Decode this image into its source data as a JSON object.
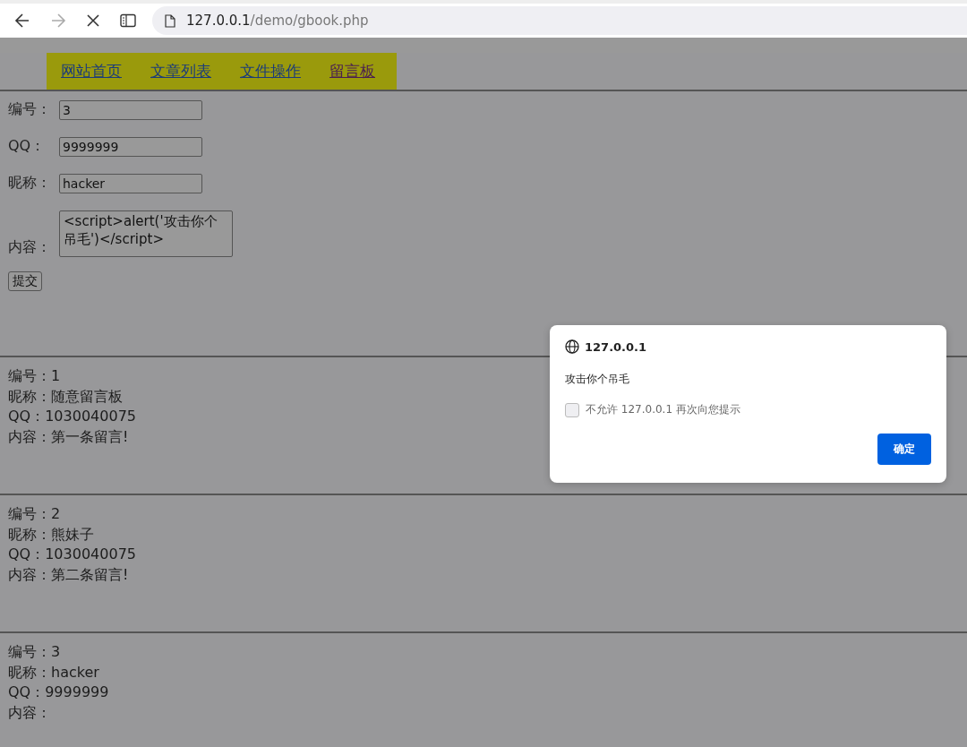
{
  "browser": {
    "url_host": "127.0.0.1",
    "url_path": "/demo/gbook.php"
  },
  "nav": [
    {
      "label": "网站首页",
      "visited": false
    },
    {
      "label": "文章列表",
      "visited": false
    },
    {
      "label": "文件操作",
      "visited": false
    },
    {
      "label": "留言板",
      "visited": true
    }
  ],
  "form": {
    "fields": [
      {
        "label": "编号：",
        "value": "3",
        "kind": "input"
      },
      {
        "label": "QQ：",
        "value": "9999999",
        "kind": "input"
      },
      {
        "label": "昵称：",
        "value": "hacker",
        "kind": "input"
      },
      {
        "label": "内容：",
        "value": "<script>alert('攻击你个吊毛')</script>",
        "kind": "textarea"
      }
    ],
    "submit": "提交"
  },
  "messages": [
    {
      "lines": [
        "编号：1",
        "昵称：随意留言板",
        "QQ：1030040075",
        "内容：第一条留言!"
      ]
    },
    {
      "lines": [
        "编号：2",
        "昵称：熊妹子",
        "QQ：1030040075",
        "内容：第二条留言!"
      ]
    },
    {
      "lines": [
        "编号：3",
        "昵称：hacker",
        "QQ：9999999",
        "内容："
      ]
    }
  ],
  "dialog": {
    "title": "127.0.0.1",
    "message": "攻击你个吊毛",
    "checkbox": {
      "label": "不允许 127.0.0.1 再次向您提示",
      "checked": false
    },
    "ok": "确定"
  }
}
